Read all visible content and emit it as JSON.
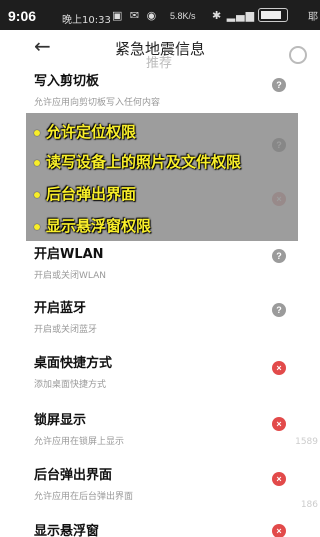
{
  "status_bar": {
    "time": "9:06",
    "label": "晚上10:33",
    "network_speed": "5.8K/s",
    "network": "4G",
    "live_label": "耶"
  },
  "header": {
    "back_icon": "back-arrow-icon",
    "title": "紧急地震信息",
    "tab_recommend": "推荐",
    "search_icon": "search-icon"
  },
  "permissions": [
    {
      "title": "写入剪切板",
      "desc": "允许应用向剪切板写入任何内容",
      "status": "question",
      "status_glyph": "?"
    },
    {
      "title": "",
      "desc": "",
      "status": "question",
      "status_glyph": "?"
    },
    {
      "title": "",
      "desc": "",
      "status": "denied",
      "status_glyph": "×"
    },
    {
      "title": "开启WLAN",
      "desc": "开启或关闭WLAN",
      "status": "question",
      "status_glyph": "?"
    },
    {
      "title": "开启蓝牙",
      "desc": "开启或关闭蓝牙",
      "status": "question",
      "status_glyph": "?"
    },
    {
      "title": "桌面快捷方式",
      "desc": "添加桌面快捷方式",
      "status": "denied",
      "status_glyph": "×"
    },
    {
      "title": "锁屏显示",
      "desc": "允许应用在锁屏上显示",
      "status": "denied",
      "status_glyph": "×"
    },
    {
      "title": "后台弹出界面",
      "desc": "允许应用在后台弹出界面",
      "status": "denied",
      "status_glyph": "×"
    },
    {
      "title": "显示悬浮窗",
      "desc": "",
      "status": "denied",
      "status_glyph": "×"
    }
  ],
  "overlay": {
    "lines": [
      "允许定位权限",
      "读写设备上的照片及文件权限",
      "后台弹出界面",
      "显示悬浮窗权限"
    ],
    "text_color": "#f8ee2a"
  },
  "side": {
    "count_1": "1589",
    "count_2": "186",
    "bubble_glyph": "•••"
  },
  "colors": {
    "denied": "#e24a4a",
    "question": "#9b9b9b"
  }
}
